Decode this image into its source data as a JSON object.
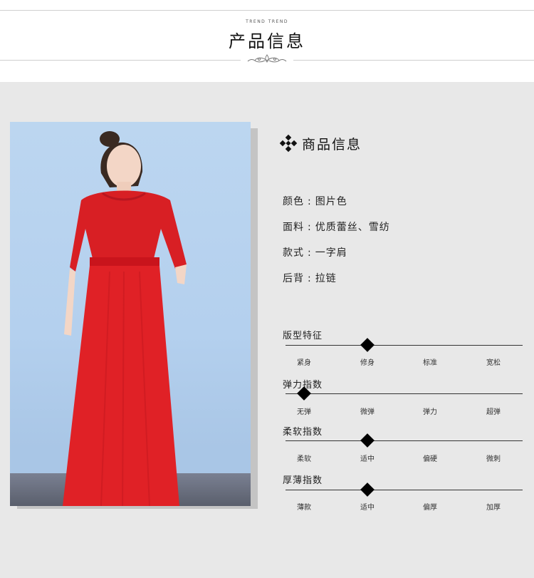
{
  "header": {
    "trend": "TREND TREND",
    "title": "产品信息"
  },
  "section": {
    "label": "商品信息"
  },
  "specs": [
    {
      "key": "颜色",
      "sep": ":",
      "value": "图片色"
    },
    {
      "key": "面料",
      "sep": ":",
      "value": "优质蕾丝、雪纺"
    },
    {
      "key": "款式",
      "sep": ":",
      "value": "一字肩"
    },
    {
      "key": "后背",
      "sep": ":",
      "value": "拉链"
    }
  ],
  "scales": [
    {
      "title": "版型特征",
      "options": [
        "紧身",
        "修身",
        "标准",
        "宽松"
      ],
      "selected_index": 1
    },
    {
      "title": "弹力指数",
      "options": [
        "无弹",
        "微弹",
        "弹力",
        "超弹"
      ],
      "selected_index": 0
    },
    {
      "title": "柔软指数",
      "options": [
        "柔软",
        "适中",
        "偏硬",
        "微刺"
      ],
      "selected_index": 1
    },
    {
      "title": "厚薄指数",
      "options": [
        "薄款",
        "适中",
        "偏厚",
        "加厚"
      ],
      "selected_index": 1
    }
  ],
  "colors": {
    "dress_red": "#e01e1e",
    "background": "#e8e8e8"
  }
}
